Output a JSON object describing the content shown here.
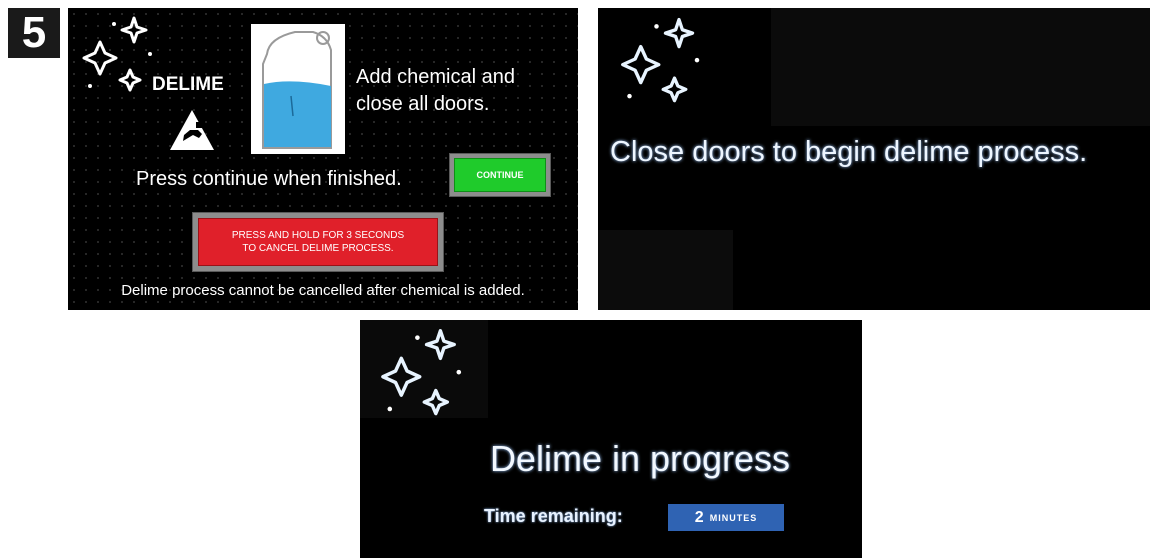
{
  "step": {
    "number": "5"
  },
  "screen1": {
    "delime_label": "DELIME",
    "instruction": [
      "Add chemical and",
      "close all doors."
    ],
    "press_text": "Press continue when finished.",
    "continue_label": "CONTINUE",
    "cancel_lines": [
      "PRESS AND HOLD FOR 3 SECONDS",
      "TO CANCEL DELIME PROCESS."
    ],
    "note": "Delime process cannot be cancelled after chemical is added."
  },
  "screen2": {
    "message": "Close doors to begin delime process."
  },
  "screen3": {
    "status": "Delime in progress",
    "time_label": "Time remaining:",
    "time_value": "2",
    "time_unit": "MINUTES"
  },
  "colors": {
    "screen_bg": "#000000",
    "continue_green": "#1fcb2b",
    "cancel_red": "#e0202a",
    "time_box_blue": "#2f63b3",
    "jug_liquid": "#3fa9e0"
  },
  "icons": [
    "sparkle-icon",
    "hand-hazard-icon",
    "chemical-jug-icon"
  ]
}
